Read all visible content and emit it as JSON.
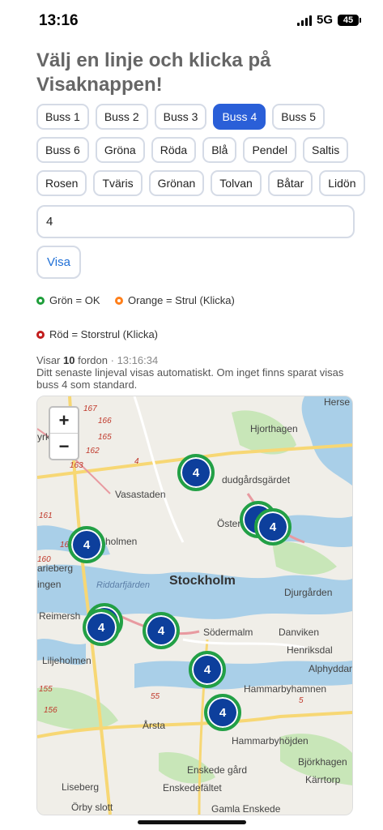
{
  "status": {
    "time": "13:16",
    "network": "5G",
    "battery": "45"
  },
  "title": "Välj en linje och klicka på Visaknappen!",
  "chips": [
    [
      {
        "label": "Buss 1"
      },
      {
        "label": "Buss 2"
      },
      {
        "label": "Buss 3"
      },
      {
        "label": "Buss 4",
        "active": true
      },
      {
        "label": "Buss 5"
      }
    ],
    [
      {
        "label": "Buss 6"
      },
      {
        "label": "Gröna"
      },
      {
        "label": "Röda"
      },
      {
        "label": "Blå"
      },
      {
        "label": "Pendel"
      },
      {
        "label": "Saltis"
      }
    ],
    [
      {
        "label": "Rosen"
      },
      {
        "label": "Tväris"
      },
      {
        "label": "Grönan"
      },
      {
        "label": "Tolvan"
      },
      {
        "label": "Båtar"
      },
      {
        "label": "Lidön"
      }
    ]
  ],
  "line_input": {
    "value": "4"
  },
  "visa_label": "Visa",
  "legend": {
    "green": "Grön = OK",
    "orange": "Orange = Strul (Klicka)",
    "red": "Röd = Storstrul (Klicka)"
  },
  "info": {
    "prefix": "Visar",
    "count": "10",
    "unit": "fordon",
    "separator": "·",
    "time": "13:16:34",
    "note": "Ditt senaste linjeval visas automatiskt. Om inget finns sparat visas buss 4 som standard."
  },
  "map": {
    "zoom_in": "+",
    "zoom_out": "−",
    "labels": {
      "stockholm": "Stockholm",
      "vasastaden": "Vasastaden",
      "hjorthagen": "Hjorthagen",
      "gardet": "dudgårdsgärdet",
      "ostermalm": "Öster",
      "djurgarden": "Djurgården",
      "sodermalm": "Södermalm",
      "danviken": "Danviken",
      "henriksdal": "Henriksdal",
      "alphyddan": "Alphyddan",
      "hammarbyhamnen": "Hammarbyhamnen",
      "hammarbyhojden": "Hammarbyhöjden",
      "bjorkhagen": "Björkhagen",
      "karrtorp": "Kärrtorp",
      "arsta": "Årsta",
      "enskede_gard": "Enskede gård",
      "enskedefaltet": "Enskedefältet",
      "gamla_enskede": "Gamla Enskede",
      "liseberg": "Liseberg",
      "orby_slott": "Örby slott",
      "liljeholmen": "Liljeholmen",
      "reimersholme": "Reimersh",
      "kungsholmen": "sholmen",
      "marieberg": "arieberg",
      "ingen": "ingen",
      "riddarfjarden": "Riddarfjärden",
      "hersby": "Herse",
      "yrkby": "yrkby"
    },
    "road_numbers": [
      "166",
      "165",
      "163",
      "162",
      "161",
      "160",
      "155",
      "156",
      "167",
      "55",
      "5",
      "4",
      "160"
    ],
    "markers": [
      "4",
      "4",
      "4",
      "4",
      "4",
      "4",
      "4",
      "4",
      "4",
      "4"
    ]
  }
}
